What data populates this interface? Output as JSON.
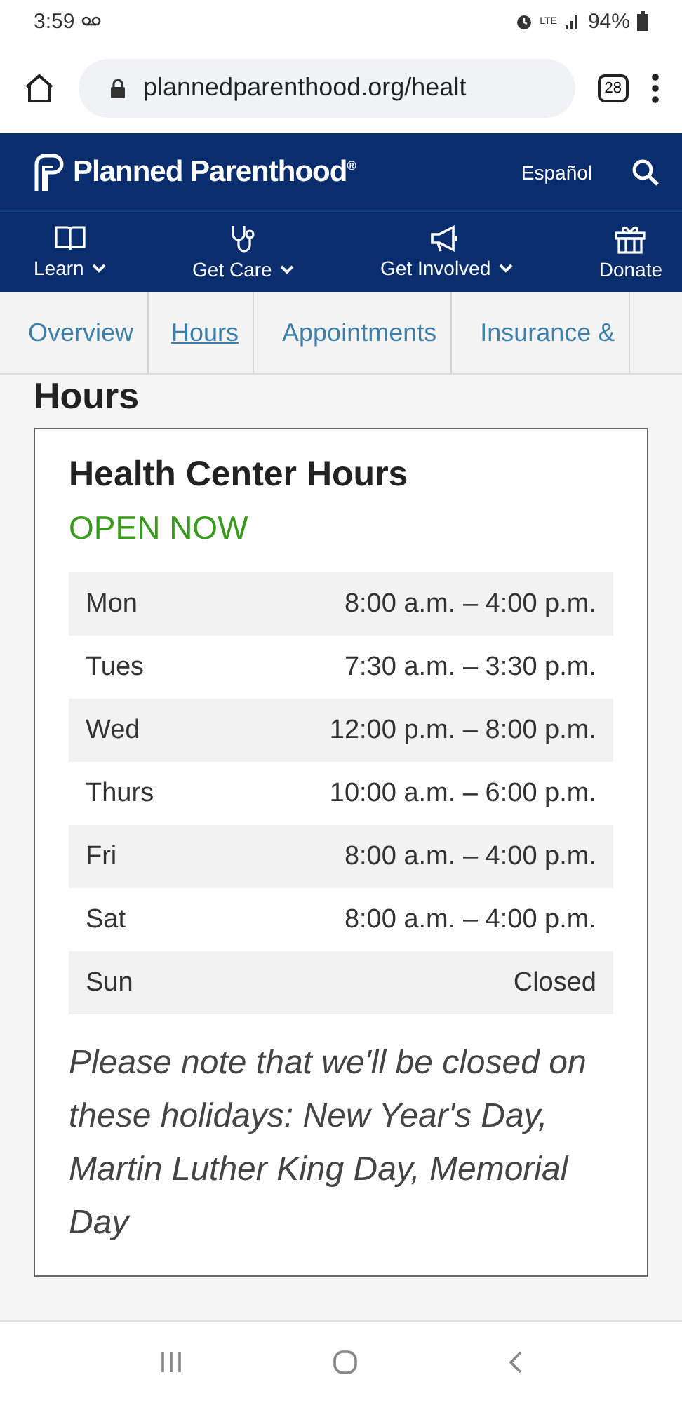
{
  "status_bar": {
    "time": "3:59",
    "network": "LTE",
    "battery": "94%"
  },
  "browser": {
    "url": "plannedparenthood.org/healt",
    "tab_count": "28"
  },
  "header": {
    "logo": "Planned Parenthood",
    "logo_mark": "®",
    "language": "Español"
  },
  "nav": [
    {
      "label": "Learn",
      "dropdown": true
    },
    {
      "label": "Get Care",
      "dropdown": true
    },
    {
      "label": "Get Involved",
      "dropdown": true
    },
    {
      "label": "Donate",
      "dropdown": false
    }
  ],
  "tabs": [
    {
      "label": "Overview",
      "selected": false
    },
    {
      "label": "Hours",
      "selected": true
    },
    {
      "label": "Appointments",
      "selected": false
    },
    {
      "label": "Insurance &",
      "selected": false
    }
  ],
  "page_heading": "Hours",
  "card": {
    "title": "Health Center Hours",
    "status": "OPEN NOW",
    "hours": [
      {
        "day": "Mon",
        "time": "8:00 a.m. – 4:00 p.m."
      },
      {
        "day": "Tues",
        "time": "7:30 a.m. – 3:30 p.m."
      },
      {
        "day": "Wed",
        "time": "12:00 p.m. – 8:00 p.m."
      },
      {
        "day": "Thurs",
        "time": "10:00 a.m. – 6:00 p.m."
      },
      {
        "day": "Fri",
        "time": "8:00 a.m. – 4:00 p.m."
      },
      {
        "day": "Sat",
        "time": "8:00 a.m. – 4:00 p.m."
      },
      {
        "day": "Sun",
        "time": "Closed"
      }
    ],
    "note": "Please note that we'll be closed on these holidays: New Year's Day, Martin Luther King Day, Memorial Day"
  }
}
